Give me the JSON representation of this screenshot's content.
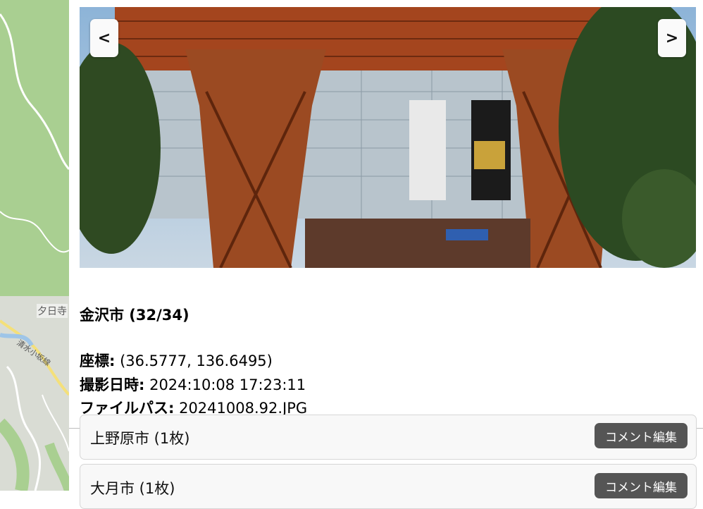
{
  "map": {
    "place_label": "夕日寺",
    "road_label": "清水小坂線"
  },
  "gallery": {
    "prev_label": "<",
    "next_label": ">",
    "title": "金沢市 (32/34)",
    "coords_label": "座標:",
    "coords_value": " (36.5777, 136.6495)",
    "date_label": "撮影日時:",
    "date_value": " 2024:10:08 17:23:11",
    "path_label": "ファイルパス:",
    "path_value": " 20241008.92.JPG"
  },
  "city_list": [
    {
      "name": "上野原市 (1枚)",
      "button": "コメント編集"
    },
    {
      "name": "大月市 (1枚)",
      "button": "コメント編集"
    }
  ]
}
